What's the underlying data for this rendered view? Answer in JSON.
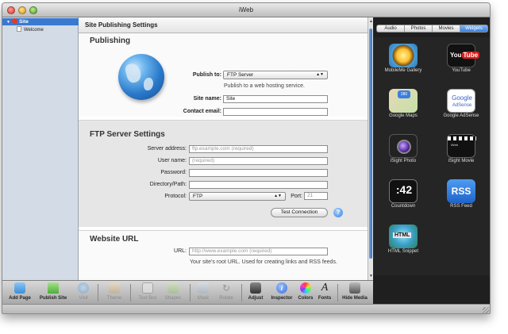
{
  "window": {
    "title": "iWeb"
  },
  "sidebar": {
    "site_label": "Site",
    "pages": [
      "Welcome"
    ]
  },
  "main": {
    "header_title": "Site Publishing Settings",
    "publishing": {
      "title": "Publishing",
      "publish_to_label": "Publish to:",
      "publish_to_value": "FTP Server",
      "publish_to_hint": "Publish to a web hosting service.",
      "site_name_label": "Site name:",
      "site_name_value": "Site",
      "contact_email_label": "Contact email:",
      "contact_email_value": ""
    },
    "ftp": {
      "title": "FTP Server Settings",
      "server_address_label": "Server address:",
      "server_address_placeholder": "ftp.example.com (required)",
      "user_name_label": "User name:",
      "user_name_placeholder": "(required)",
      "password_label": "Password:",
      "directory_label": "Directory/Path:",
      "protocol_label": "Protocol:",
      "protocol_value": "FTP",
      "port_label": "Port:",
      "port_placeholder": "21",
      "test_button": "Test Connection",
      "help_icon": "?"
    },
    "website_url": {
      "title": "Website URL",
      "url_label": "URL:",
      "url_placeholder": "http://www.example.com (required)",
      "url_hint": "Your site's root URL. Used for creating links and RSS feeds."
    }
  },
  "media_browser": {
    "tabs": [
      {
        "label": "Audio",
        "active": false
      },
      {
        "label": "Photos",
        "active": false
      },
      {
        "label": "Movies",
        "active": false
      },
      {
        "label": "Widgets",
        "active": true
      }
    ],
    "widgets": [
      {
        "label": "MobileMe Gallery",
        "icon": "mobileme-gallery-icon"
      },
      {
        "label": "YouTube",
        "icon": "youtube-icon",
        "icon_text_a": "You",
        "icon_text_b": "Tube"
      },
      {
        "label": "Google Maps",
        "icon": "google-maps-icon",
        "icon_text": "280"
      },
      {
        "label": "Google AdSense",
        "icon": "google-adsense-icon",
        "icon_text_a": "Google",
        "icon_text_b": "AdSense"
      },
      {
        "label": "iSight Photo",
        "icon": "isight-photo-icon"
      },
      {
        "label": "iSight Movie",
        "icon": "isight-movie-icon",
        "icon_text": "iWeb"
      },
      {
        "label": "Countdown",
        "icon": "countdown-icon",
        "icon_text": ":42"
      },
      {
        "label": "RSS Feed",
        "icon": "rss-feed-icon",
        "icon_text": "RSS"
      },
      {
        "label": "HTML Snippet",
        "icon": "html-snippet-icon",
        "icon_text": "HTML"
      }
    ]
  },
  "toolbar": {
    "items": [
      {
        "label": "Add Page",
        "enabled": true,
        "color": "#3b8fd6"
      },
      {
        "label": "Publish Site",
        "enabled": true,
        "color": "#4caf3b"
      },
      {
        "label": "Visit",
        "enabled": false,
        "color": "#3b8fd6"
      },
      {
        "label": "Theme",
        "enabled": false,
        "color": "#c9a56a"
      },
      {
        "label": "Text Box",
        "enabled": false,
        "color": "#bdbdbd"
      },
      {
        "label": "Shapes",
        "enabled": false,
        "color": "#8fbf6a"
      },
      {
        "label": "Mask",
        "enabled": false,
        "color": "#9fb0c8"
      },
      {
        "label": "Rotate",
        "enabled": false,
        "color": "#9a9a9a"
      },
      {
        "label": "Adjust",
        "enabled": true,
        "color": "#444444"
      },
      {
        "label": "Inspector",
        "enabled": true,
        "color": "#3a6fd8"
      },
      {
        "label": "Colors",
        "enabled": true,
        "color": "#e04bb0"
      },
      {
        "label": "Fonts",
        "enabled": true,
        "color": "#333333"
      },
      {
        "label": "Hide Media",
        "enabled": true,
        "color": "#555555"
      }
    ]
  }
}
